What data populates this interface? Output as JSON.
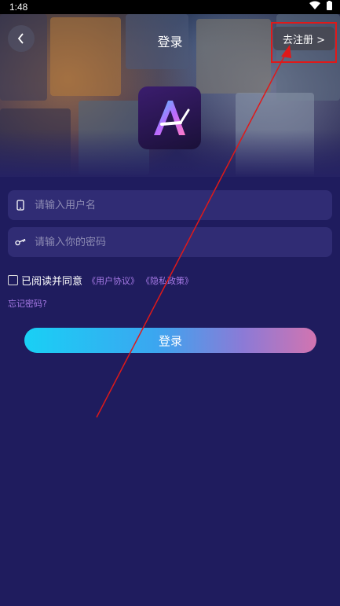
{
  "status_bar": {
    "time": "1:48"
  },
  "header": {
    "title": "登录",
    "register_label": "去注册 >"
  },
  "form": {
    "username_placeholder": "请输入用户名",
    "password_placeholder": "请输入你的密码",
    "agree_label": "已阅读并同意",
    "user_agreement": "《用户协议》",
    "privacy_policy": "《隐私政策》",
    "forgot_password": "忘记密码?",
    "login_button": "登录"
  },
  "colors": {
    "background": "#1f1c5e",
    "field": "#302c74",
    "link": "#a77ae6",
    "annotation": "#e01919"
  },
  "icons": [
    "back-icon",
    "wifi-icon",
    "battery-icon",
    "phone-icon",
    "key-icon",
    "app-logo-icon"
  ]
}
